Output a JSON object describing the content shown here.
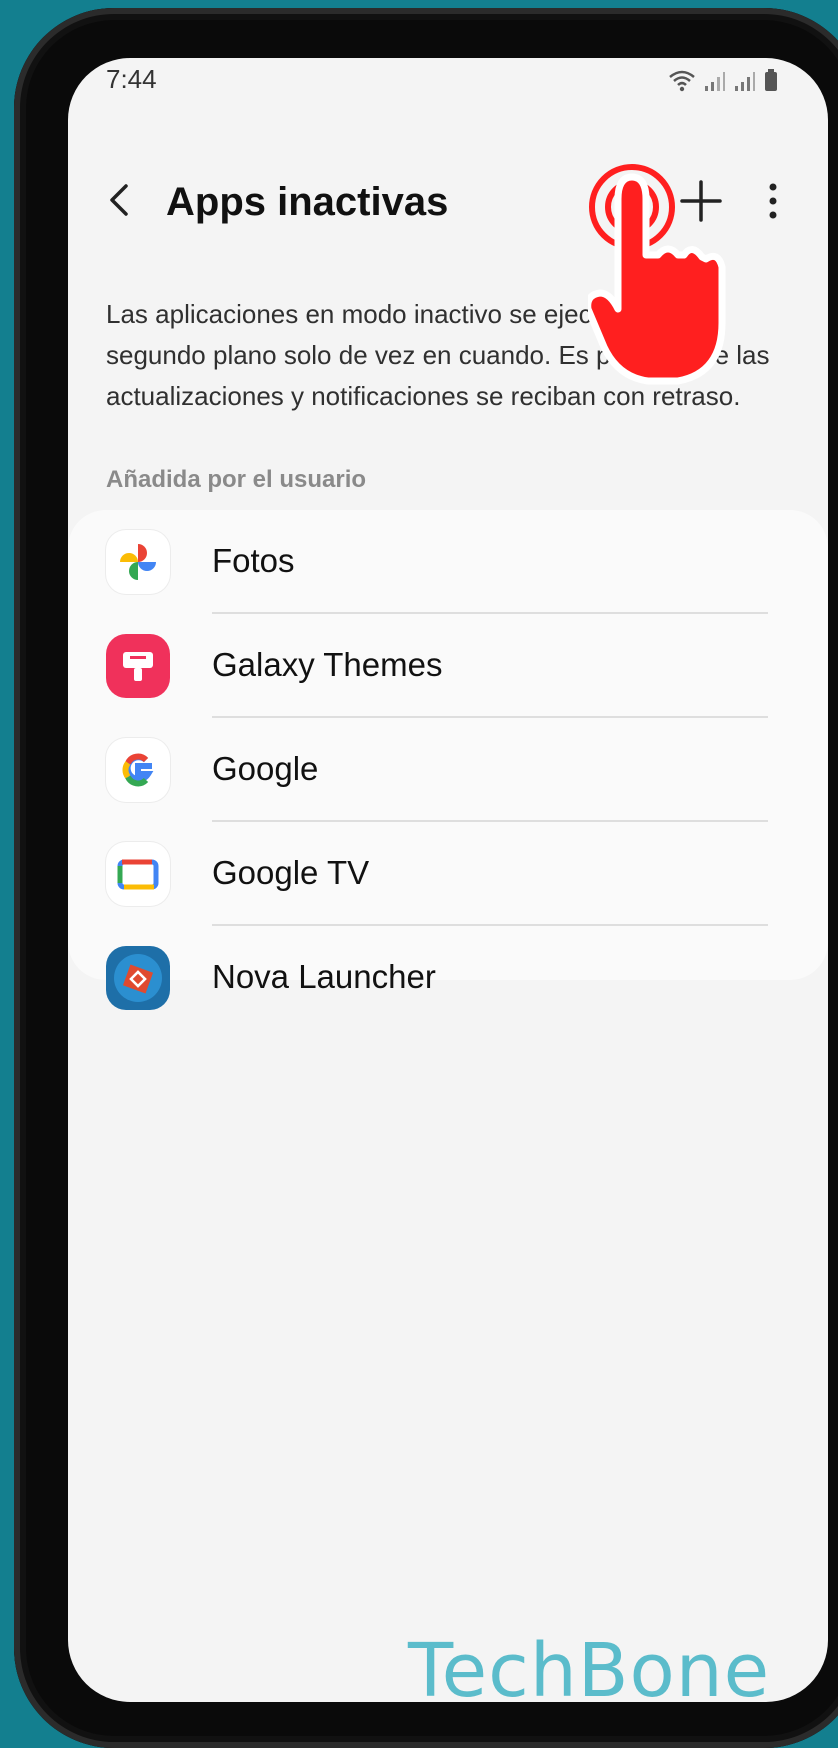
{
  "status_bar": {
    "time": "7:44"
  },
  "header": {
    "title": "Apps inactivas"
  },
  "description": "Las aplicaciones en modo inactivo se ejecutarán en segundo plano solo de vez en cuando. Es posible que las actualizaciones y notificaciones se reciban con retraso.",
  "section": {
    "label": "Añadida por el usuario"
  },
  "apps": [
    {
      "label": "Fotos",
      "icon": "google-photos-icon"
    },
    {
      "label": "Galaxy Themes",
      "icon": "galaxy-themes-icon"
    },
    {
      "label": "Google",
      "icon": "google-icon"
    },
    {
      "label": "Google TV",
      "icon": "google-tv-icon"
    },
    {
      "label": "Nova Launcher",
      "icon": "nova-launcher-icon"
    }
  ],
  "watermark": {
    "text": "TechBone",
    "color": "#5bbccb"
  },
  "colors": {
    "background": "#137f8f",
    "screen": "#f4f4f4",
    "tap_indicator": "#ff1f1f"
  }
}
